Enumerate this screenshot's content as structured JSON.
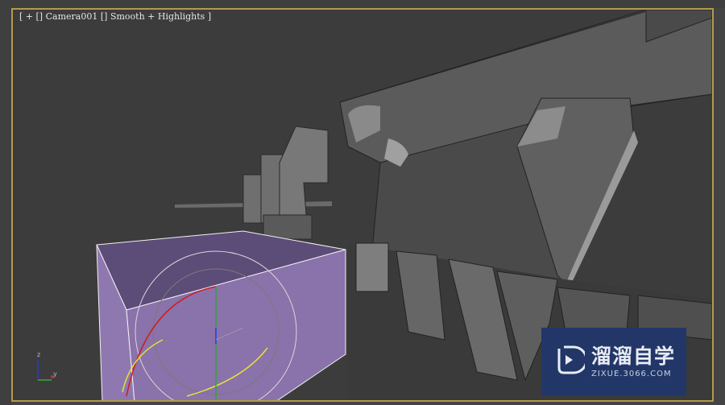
{
  "viewport": {
    "label_open": "[",
    "plus_menu": "+",
    "camera_menu": "Camera001",
    "shading_menu": "Smooth + Highlights",
    "label_close": "]",
    "separator": "[]"
  },
  "axis_tripod": {
    "z": "z",
    "y": "y"
  },
  "watermark": {
    "title": "溜溜自学",
    "url": "ZIXUE.3066.COM"
  },
  "colors": {
    "viewport_border": "#b49a4a",
    "box": "#8f78b0",
    "watermark_bg": "#223768"
  }
}
